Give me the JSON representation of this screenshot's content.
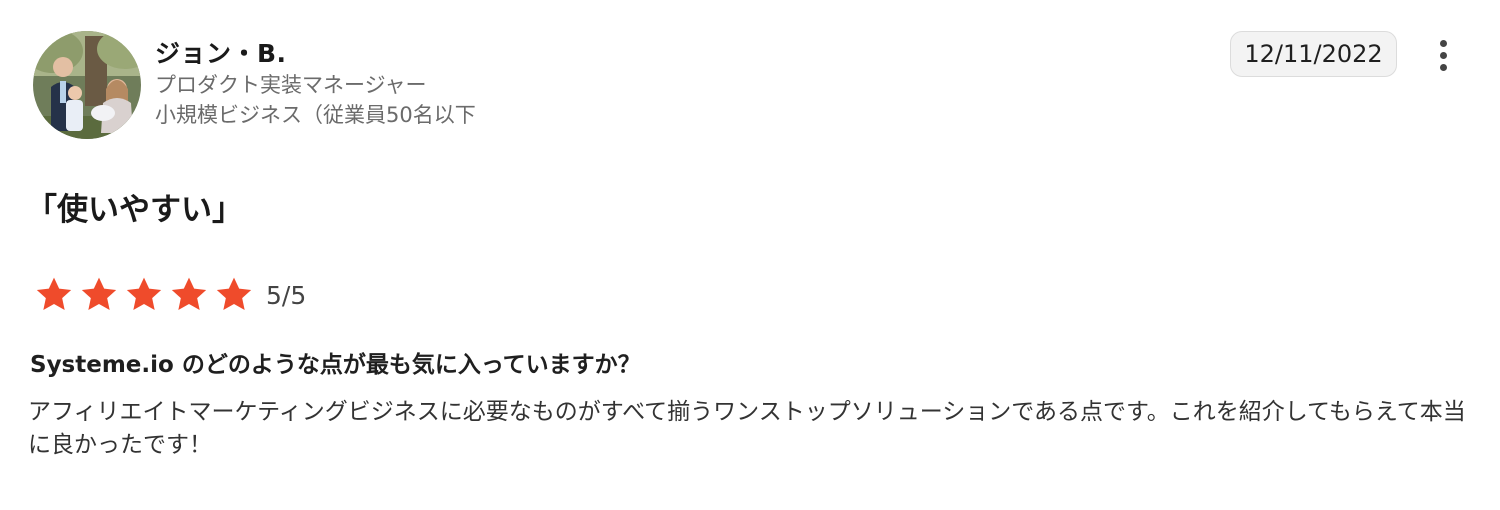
{
  "review": {
    "author": {
      "name": "ジョン・B.",
      "role": "プロダクト実装マネージャー",
      "company": "小規模ビジネス（従業員50名以下"
    },
    "date": "12/11/2022",
    "more_icon": "more-vertical-icon",
    "title": "「使いやすい」",
    "rating": {
      "stars": 5,
      "max": 5,
      "label": "5/5",
      "star_color": "#ef4b2b"
    },
    "question": "Systeme.io のどのような点が最も気に入っていますか？",
    "answer": "アフィリエイトマーケティングビジネスに必要なものがすべて揃うワンストップソリューションである点です。これを紹介してもらえて本当に良かったです！"
  }
}
